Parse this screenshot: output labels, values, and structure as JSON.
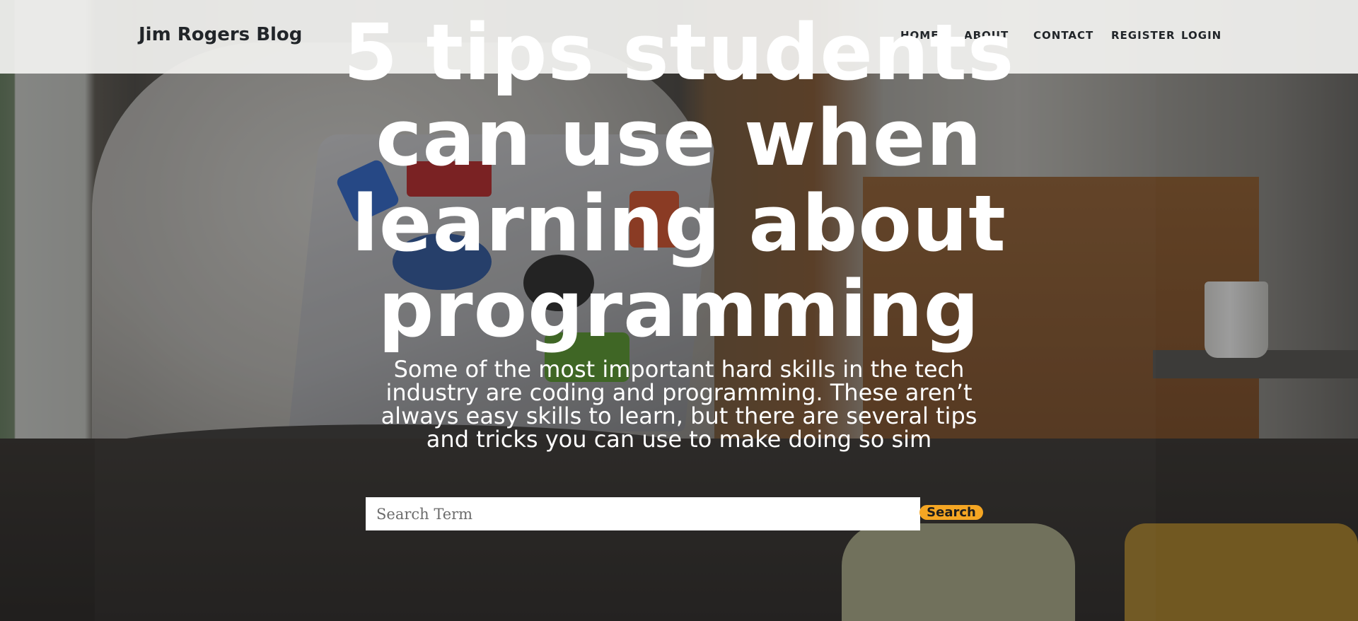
{
  "navbar": {
    "brand": "Jim Rogers Blog",
    "links": [
      {
        "label": "HOME"
      },
      {
        "label": "ABOUT"
      },
      {
        "label": "CONTACT"
      },
      {
        "label": "REGISTER"
      },
      {
        "label": "LOGIN"
      }
    ]
  },
  "hero": {
    "title": "5 tips students can use when learning about programming",
    "subtitle": "Some of the most important hard skills in the tech industry are coding and programming. These aren’t always easy skills to learn, but there are several tips and tricks you can use to make doing so sim"
  },
  "search": {
    "placeholder": "Search Term",
    "value": "",
    "button_label": "Search"
  },
  "colors": {
    "accent": "#f5a623",
    "navbar_bg": "#f2f2f0",
    "text_dark": "#212529",
    "hero_text": "#ffffff"
  }
}
